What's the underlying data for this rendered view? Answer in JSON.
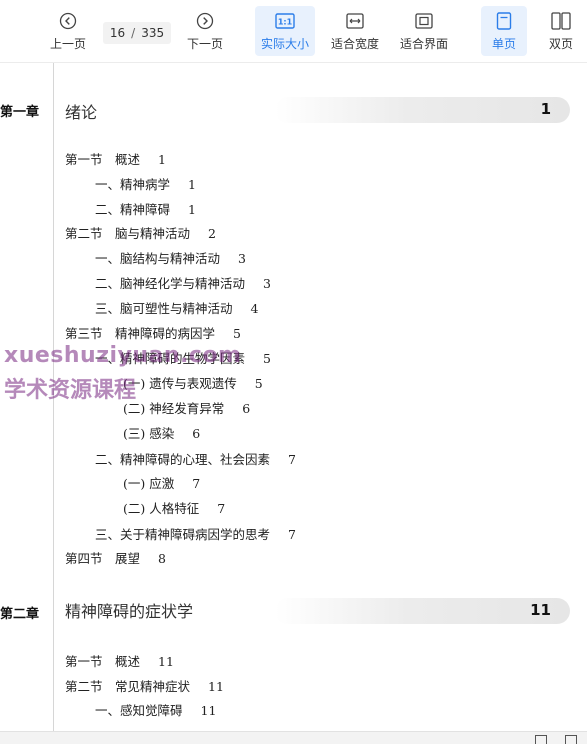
{
  "toolbar": {
    "prev_label": "上一页",
    "current_page": "16",
    "separator": "/",
    "total_pages": "335",
    "next_label": "下一页",
    "actual_size_label": "实际大小",
    "fit_width_label": "适合宽度",
    "fit_page_label": "适合界面",
    "single_page_label": "单页",
    "double_page_label": "双页",
    "accent_color": "#2b7de9"
  },
  "watermark": {
    "line1": "xueshuziyuan.com",
    "line2": "学术资源课程"
  },
  "chapters": [
    {
      "label": "第一章",
      "title": "绪论",
      "page": "1",
      "entries": [
        {
          "text": "第一节　概述",
          "page": "1"
        },
        {
          "text": "一、精神病学",
          "page": "1"
        },
        {
          "text": "二、精神障碍",
          "page": "1"
        },
        {
          "text": "第二节　脑与精神活动",
          "page": "2"
        },
        {
          "text": "一、脑结构与精神活动",
          "page": "3"
        },
        {
          "text": "二、脑神经化学与精神活动",
          "page": "3"
        },
        {
          "text": "三、脑可塑性与精神活动",
          "page": "4"
        },
        {
          "text": "第三节　精神障碍的病因学",
          "page": "5"
        },
        {
          "text": "一、精神障碍的生物学因素",
          "page": "5"
        },
        {
          "text": "(一) 遗传与表观遗传",
          "page": "5"
        },
        {
          "text": "(二) 神经发育异常",
          "page": "6"
        },
        {
          "text": "(三) 感染",
          "page": "6"
        },
        {
          "text": "二、精神障碍的心理、社会因素",
          "page": "7"
        },
        {
          "text": "(一) 应激",
          "page": "7"
        },
        {
          "text": "(二) 人格特征",
          "page": "7"
        },
        {
          "text": "三、关于精神障碍病因学的思考",
          "page": "7"
        },
        {
          "text": "第四节　展望",
          "page": "8"
        }
      ]
    },
    {
      "label": "第二章",
      "title": "精神障碍的症状学",
      "page": "11",
      "entries": [
        {
          "text": "第一节　概述",
          "page": "11"
        },
        {
          "text": "第二节　常见精神症状",
          "page": "11"
        },
        {
          "text": "一、感知觉障碍",
          "page": "11"
        }
      ]
    }
  ]
}
